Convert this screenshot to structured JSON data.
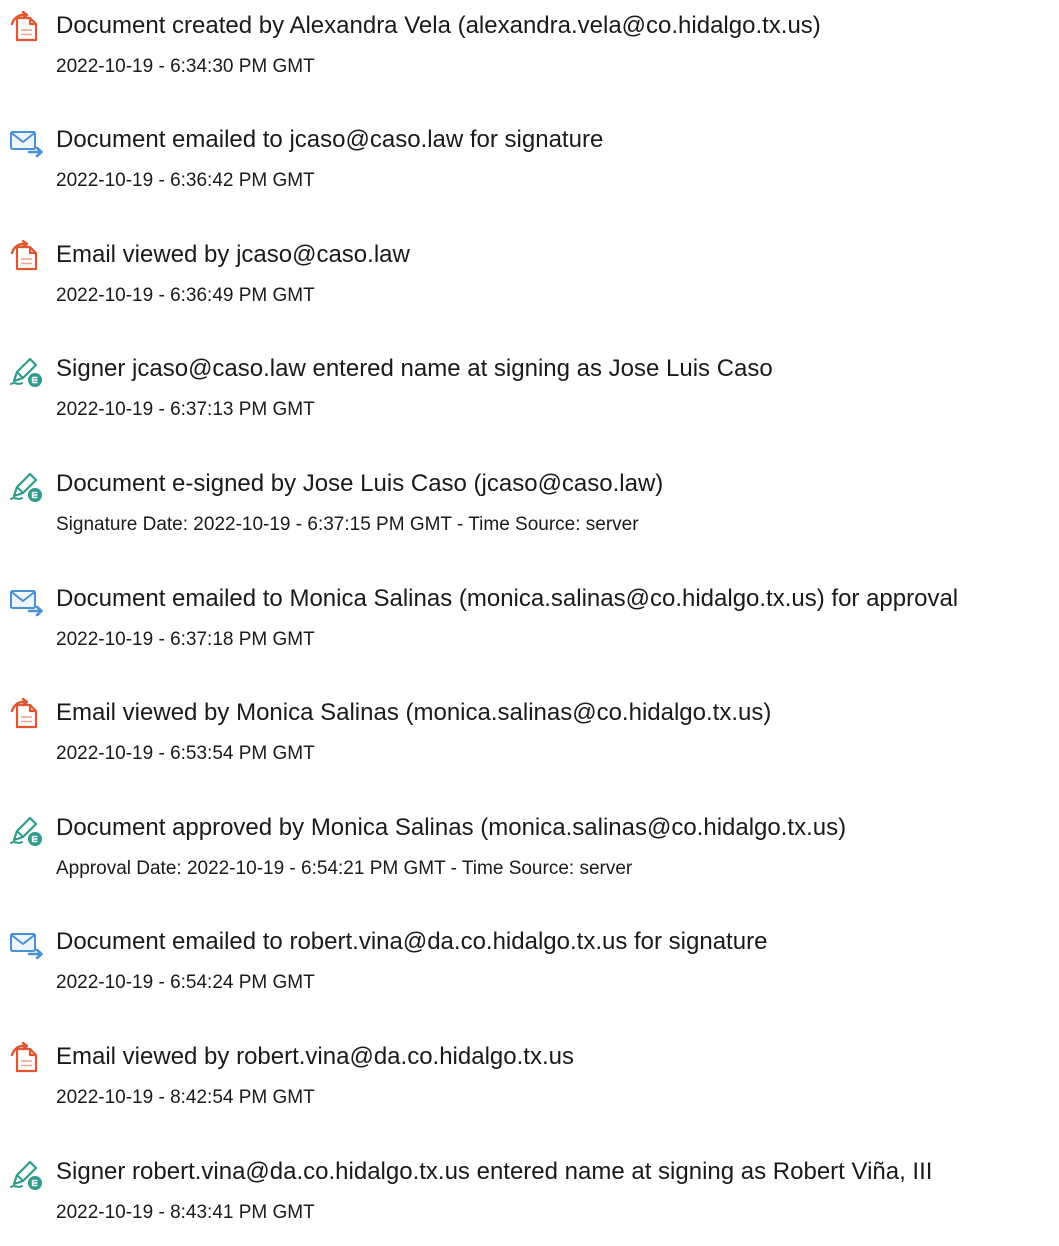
{
  "colors": {
    "document_icon": "#e0572f",
    "email_icon": "#4a90d9",
    "sign_icon": "#2e9b8a"
  },
  "entries": [
    {
      "icon": "document-icon",
      "title": "Document created by Alexandra Vela (alexandra.vela@co.hidalgo.tx.us)",
      "detail": "2022-10-19 - 6:34:30 PM GMT"
    },
    {
      "icon": "email-icon",
      "title": "Document emailed to jcaso@caso.law for signature",
      "detail": "2022-10-19 - 6:36:42 PM GMT"
    },
    {
      "icon": "document-icon",
      "title": "Email viewed by jcaso@caso.law",
      "detail": "2022-10-19 - 6:36:49 PM GMT"
    },
    {
      "icon": "sign-icon",
      "title": "Signer jcaso@caso.law entered name at signing as Jose Luis Caso",
      "detail": "2022-10-19 - 6:37:13 PM GMT"
    },
    {
      "icon": "sign-icon",
      "title": "Document e-signed by Jose Luis Caso (jcaso@caso.law)",
      "detail": "Signature Date: 2022-10-19 - 6:37:15 PM GMT - Time Source: server"
    },
    {
      "icon": "email-icon",
      "title": "Document emailed to Monica Salinas (monica.salinas@co.hidalgo.tx.us) for approval",
      "detail": "2022-10-19 - 6:37:18 PM GMT"
    },
    {
      "icon": "document-icon",
      "title": "Email viewed by Monica Salinas (monica.salinas@co.hidalgo.tx.us)",
      "detail": "2022-10-19 - 6:53:54 PM GMT"
    },
    {
      "icon": "sign-icon",
      "title": "Document approved by Monica Salinas (monica.salinas@co.hidalgo.tx.us)",
      "detail": "Approval Date: 2022-10-19 - 6:54:21 PM GMT - Time Source: server"
    },
    {
      "icon": "email-icon",
      "title": "Document emailed to robert.vina@da.co.hidalgo.tx.us for signature",
      "detail": "2022-10-19 - 6:54:24 PM GMT"
    },
    {
      "icon": "document-icon",
      "title": "Email viewed by robert.vina@da.co.hidalgo.tx.us",
      "detail": "2022-10-19 - 8:42:54 PM GMT"
    },
    {
      "icon": "sign-icon",
      "title": "Signer robert.vina@da.co.hidalgo.tx.us entered name at signing as Robert Viña, III",
      "detail": "2022-10-19 - 8:43:41 PM GMT"
    }
  ]
}
